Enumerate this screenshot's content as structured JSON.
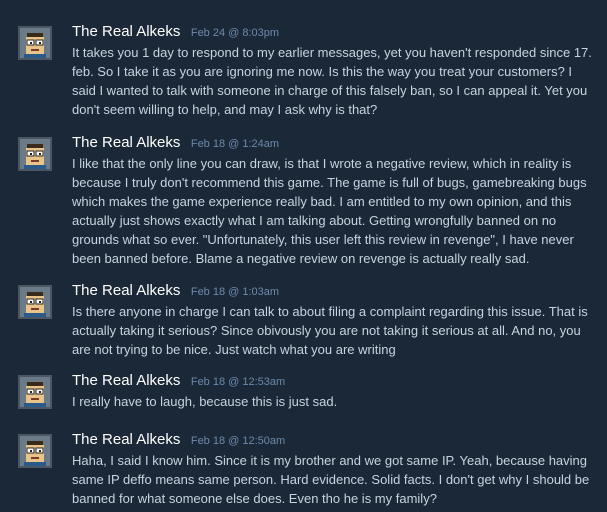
{
  "colors": {
    "background": "#1b2838",
    "author": "#ffffff",
    "date": "#6b8aaa",
    "text": "#c6d4df"
  },
  "comments": [
    {
      "author": "The Real Alkeks",
      "date": "Feb 24 @ 8:03pm",
      "text": "It takes you 1 day to respond to my earlier messages, yet you haven't responded since 17. feb. So I take it as you are ignoring me now. Is this the way you treat your customers? I said I wanted to talk with someone in charge of this falsely ban, so I can appeal it. Yet you don't seem willing to help, and may I ask why is that?"
    },
    {
      "author": "The Real Alkeks",
      "date": "Feb 18 @ 1:24am",
      "text": "I like that the only line you can draw, is that I wrote a negative review, which in reality is because I truly don't recommend this game. The game is full of bugs, gamebreaking bugs which makes the game experience really bad. I am entitled to my own opinion, and this actually just shows exactly what I am talking about. Getting wrongfully banned on no grounds what so ever. \"Unfortunately, this user left this review in revenge\", I have never been banned before. Blame a negative review on revenge is actually really sad."
    },
    {
      "author": "The Real Alkeks",
      "date": "Feb 18 @ 1:03am",
      "text": "Is there anyone in charge I can talk to about filing a complaint regarding this issue. That is actually taking it serious? Since obivously you are not taking it serious at all. And no, you are not trying to be nice. Just watch what you are writing"
    },
    {
      "author": "The Real Alkeks",
      "date": "Feb 18 @ 12:53am",
      "text": "I really have to laugh, because this is just sad."
    },
    {
      "author": "The Real Alkeks",
      "date": "Feb 18 @ 12:50am",
      "text": "Haha, I said I know him. Since it is my brother and we got same IP. Yeah, because having same IP deffo means same person. Hard evidence. Solid facts. I don't get why I should be banned for what someone else does. Even tho he is my family?"
    }
  ]
}
